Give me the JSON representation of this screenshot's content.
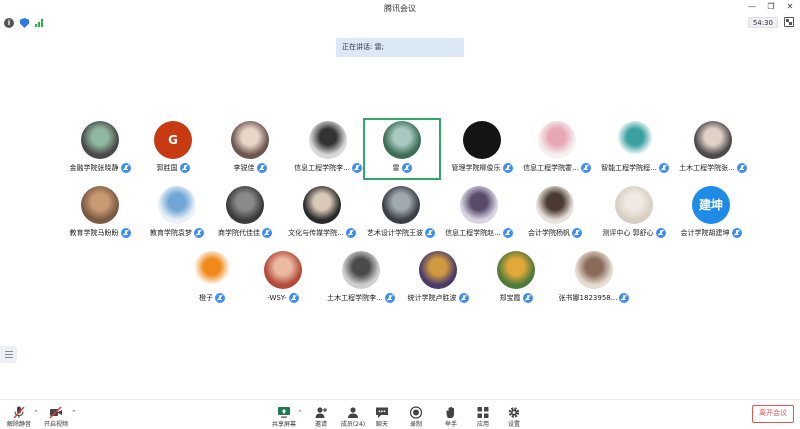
{
  "window": {
    "title": "腾讯会议",
    "timer": "54:30"
  },
  "banner": {
    "speaking_text": "正在讲话: 雷;"
  },
  "participants": [
    {
      "name": "金融学院张晓静",
      "avatar": "#4a4a4a",
      "accent": "#8fb8a0",
      "initials": ""
    },
    {
      "name": "郭胜国",
      "avatar": "#c83a12",
      "accent": "#f2a23a",
      "initials": "G"
    },
    {
      "name": "李锐佳",
      "avatar": "#6b5650",
      "accent": "#e9d6c8",
      "initials": ""
    },
    {
      "name": "信息工程学院李...",
      "avatar": "#d9d9d9",
      "accent": "#333",
      "initials": ""
    },
    {
      "name": "雷",
      "avatar": "#3c6e57",
      "accent": "#a9c9c0",
      "initials": "",
      "active": true
    },
    {
      "name": "管理学院柳俊乐",
      "avatar": "#141414",
      "accent": "#141414",
      "initials": ""
    },
    {
      "name": "信息工程学院霍...",
      "avatar": "#f6f0f0",
      "accent": "#e7a8b6",
      "initials": ""
    },
    {
      "name": "智能工程学院程...",
      "avatar": "#ffffff",
      "accent": "#3aa0a0",
      "initials": ""
    },
    {
      "name": "土木工程学院张...",
      "avatar": "#4d4a4c",
      "accent": "#e0d0c6",
      "initials": ""
    },
    {
      "name": "教育学院马盼盼",
      "avatar": "#7a5a43",
      "accent": "#c89a72",
      "initials": ""
    },
    {
      "name": "教育学院袁梦",
      "avatar": "#eaf1f6",
      "accent": "#6fa6d6",
      "initials": ""
    },
    {
      "name": "商学院代佳佳",
      "avatar": "#3b3b3b",
      "accent": "#8a8a8a",
      "initials": ""
    },
    {
      "name": "文化与传媒学院...",
      "avatar": "#2a2a2a",
      "accent": "#d8c8b8",
      "initials": ""
    },
    {
      "name": "艺术设计学院王波",
      "avatar": "#3a3f45",
      "accent": "#a0a8b0",
      "initials": ""
    },
    {
      "name": "信息工程学院赵...",
      "avatar": "#d8d4e4",
      "accent": "#5a4a6a",
      "initials": ""
    },
    {
      "name": "会计学院杨帆",
      "avatar": "#e8e2dc",
      "accent": "#4a3a30",
      "initials": ""
    },
    {
      "name": "测评中心 郭舒心",
      "avatar": "#d8cfc4",
      "accent": "#efe9e1",
      "initials": ""
    },
    {
      "name": "会计学院胡建坤",
      "avatar": "#1e8be6",
      "accent": "#1e8be6",
      "initials": "建坤"
    },
    {
      "name": "橙子",
      "avatar": "#ffffff",
      "accent": "#f08a1a",
      "initials": ""
    },
    {
      "name": "-WSY-",
      "avatar": "#b34a3a",
      "accent": "#e9b9a0",
      "initials": ""
    },
    {
      "name": "土木工程学院李...",
      "avatar": "#cfcfcf",
      "accent": "#4a4a4a",
      "initials": ""
    },
    {
      "name": "统计学院卢胜波",
      "avatar": "#4a3a6a",
      "accent": "#d09a40",
      "initials": ""
    },
    {
      "name": "郑宝霞",
      "avatar": "#4e7a3a",
      "accent": "#e2a83a",
      "initials": ""
    },
    {
      "name": "张书娜1823958...",
      "avatar": "#e6dcd2",
      "accent": "#8a6a5a",
      "initials": ""
    }
  ],
  "toolbar": {
    "unmute": "解除静音",
    "start_video": "开启视频",
    "share_screen": "共享屏幕",
    "invite": "邀请",
    "members": "成员(24)",
    "chat": "聊天",
    "record": "录制",
    "raise_hand": "举手",
    "apps": "应用",
    "settings": "设置",
    "leave": "离开会议"
  }
}
